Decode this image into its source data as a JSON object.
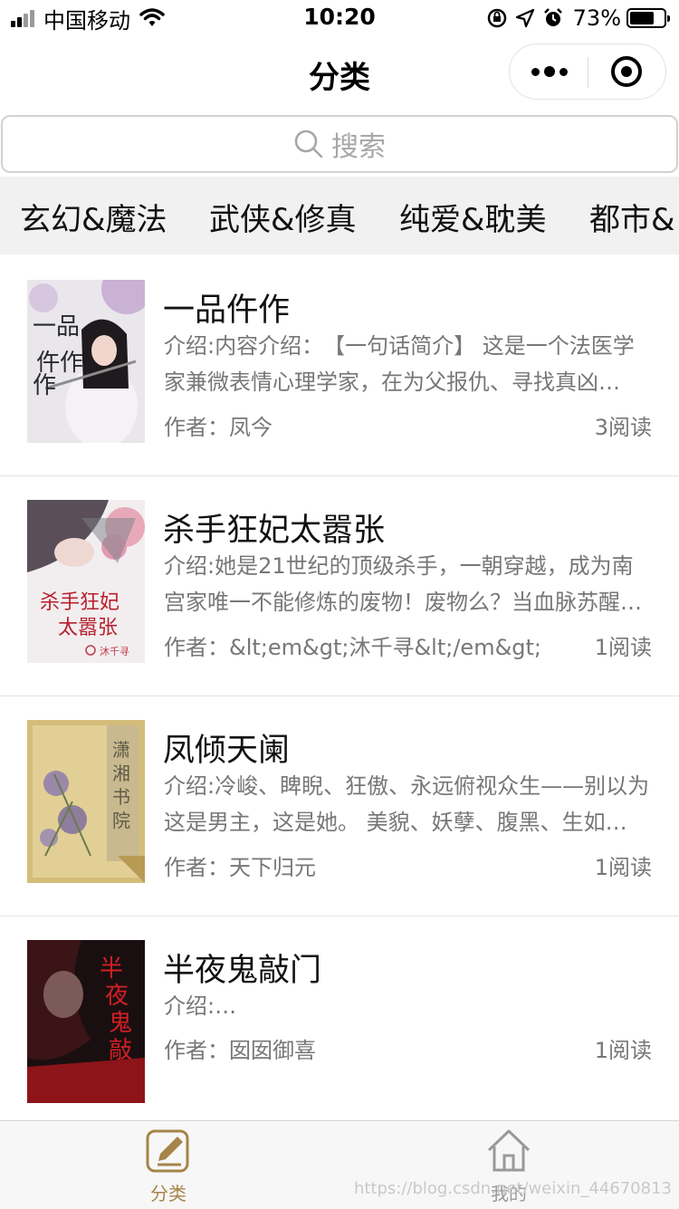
{
  "status_bar": {
    "carrier": "中国移动",
    "time": "10:20",
    "battery": "73%",
    "battery_level": 0.73
  },
  "nav": {
    "title": "分类"
  },
  "search": {
    "placeholder": "搜索"
  },
  "categories": [
    "玄幻&魔法",
    "武侠&修真",
    "纯爱&耽美",
    "都市&"
  ],
  "books": [
    {
      "title": "一品仵作",
      "intro": "介绍:内容介绍：　【一句话简介】 这是一个法医学家兼微表情心理学家，在为父报仇、寻找真凶…",
      "author": "作者：凤今",
      "reads": "3阅读"
    },
    {
      "title": "杀手狂妃太嚣张",
      "intro": "介绍:她是21世纪的顶级杀手，一朝穿越，成为南宫家唯一不能修炼的废物！废物么？当血脉苏醒…",
      "author": "作者：&lt;em&gt;沐千寻&lt;/em&gt;",
      "reads": "1阅读"
    },
    {
      "title": "凤倾天阑",
      "intro": "介绍:冷峻、睥睨、狂傲、永远俯视众生——别以为这是男主，这是她。 美貌、妖孽、腹黑、生如…",
      "author": "作者：天下归元",
      "reads": "1阅读"
    },
    {
      "title": "半夜鬼敲门",
      "intro": "介绍:…",
      "author": "作者：囡囡御喜",
      "reads": "1阅读"
    }
  ],
  "tabbar": {
    "items": [
      {
        "label": "分类",
        "icon": "edit-icon",
        "active": true
      },
      {
        "label": "我的",
        "icon": "home-icon",
        "active": false
      }
    ]
  },
  "watermark": "https://blog.csdn.net/weixin_44670813",
  "colors": {
    "accent": "#a58549",
    "category_bg": "#f1f1f1"
  }
}
